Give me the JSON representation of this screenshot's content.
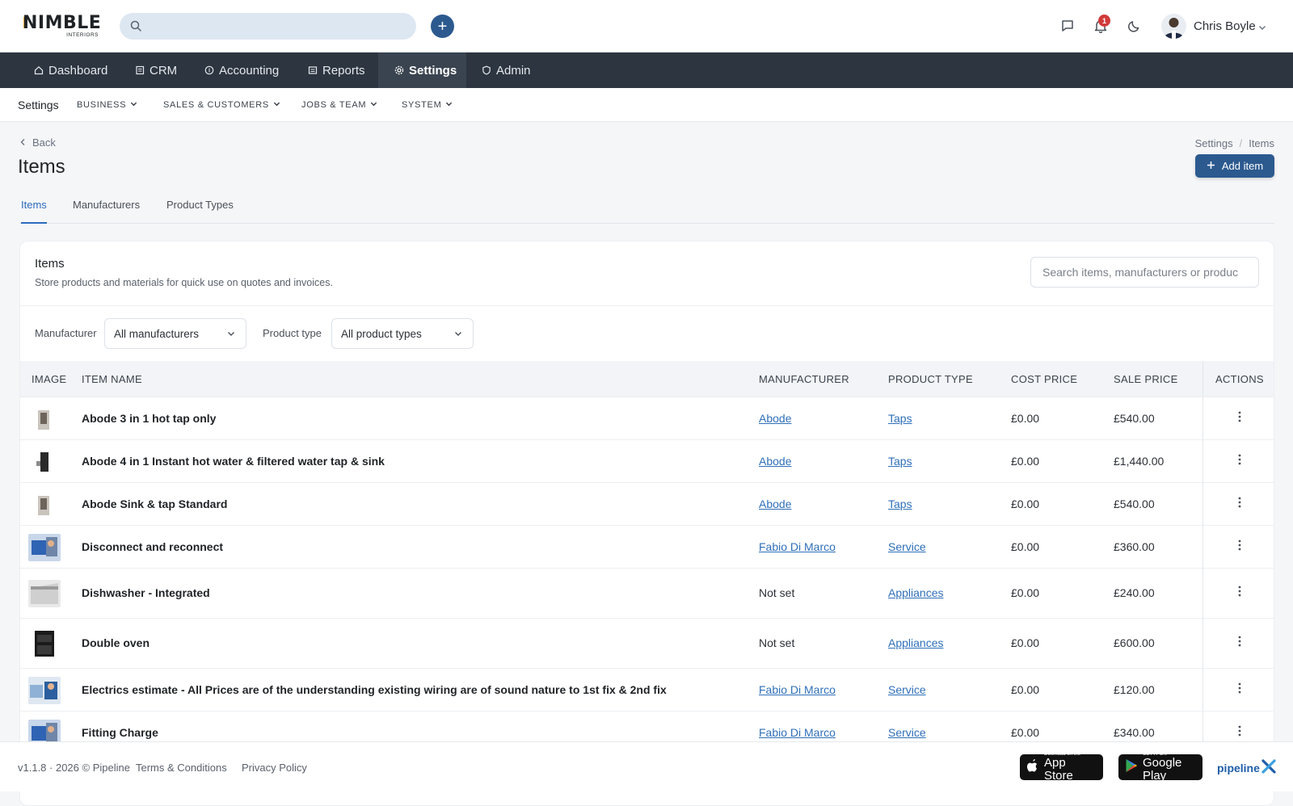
{
  "brand": {
    "name": "NIMBLE",
    "sub": "INTERIORS"
  },
  "header": {
    "search_placeholder": "",
    "quick_add_label": "+",
    "notification_count": "1",
    "user_name": "Chris Boyle"
  },
  "nav": {
    "items": [
      {
        "label": "Dashboard",
        "icon": "home-icon"
      },
      {
        "label": "CRM",
        "icon": "contacts-icon"
      },
      {
        "label": "Accounting",
        "icon": "coin-icon"
      },
      {
        "label": "Reports",
        "icon": "report-icon"
      },
      {
        "label": "Settings",
        "icon": "gear-icon",
        "active": true
      },
      {
        "label": "Admin",
        "icon": "shield-icon"
      }
    ]
  },
  "subnav": {
    "title": "Settings",
    "items": [
      "BUSINESS",
      "SALES & CUSTOMERS",
      "JOBS & TEAM",
      "SYSTEM"
    ]
  },
  "page": {
    "back": "Back",
    "title": "Items",
    "breadcrumb": [
      "Settings",
      "/",
      "Items"
    ],
    "add_button": "Add item"
  },
  "tabs": [
    "Items",
    "Manufacturers",
    "Product Types"
  ],
  "card": {
    "title": "Items",
    "subtitle": "Store products and materials for quick use on quotes and invoices.",
    "search_placeholder": "Search items, manufacturers or produc"
  },
  "filters": {
    "manufacturer_label": "Manufacturer",
    "manufacturer_value": "All manufacturers",
    "product_type_label": "Product type",
    "product_type_value": "All product types"
  },
  "table": {
    "headers": [
      "IMAGE",
      "ITEM NAME",
      "MANUFACTURER",
      "PRODUCT TYPE",
      "COST PRICE",
      "SALE PRICE",
      "ACTIONS"
    ],
    "rows": [
      {
        "name": "Abode 3 in 1 hot tap only",
        "manufacturer": "Abode",
        "manufacturer_link": true,
        "product_type": "Taps",
        "cost": "£0.00",
        "sale": "£540.00",
        "thumb": "tap"
      },
      {
        "name": "Abode 4 in 1 Instant hot water & filtered water tap & sink",
        "manufacturer": "Abode",
        "manufacturer_link": true,
        "product_type": "Taps",
        "cost": "£0.00",
        "sale": "£1,440.00",
        "thumb": "tap-dark"
      },
      {
        "name": "Abode Sink & tap Standard",
        "manufacturer": "Abode",
        "manufacturer_link": true,
        "product_type": "Taps",
        "cost": "£0.00",
        "sale": "£540.00",
        "thumb": "tap"
      },
      {
        "name": "Disconnect and reconnect",
        "manufacturer": "Fabio Di Marco",
        "manufacturer_link": true,
        "product_type": "Service",
        "cost": "£0.00",
        "sale": "£360.00",
        "thumb": "service"
      },
      {
        "name": "Dishwasher - Integrated",
        "manufacturer": "Not set",
        "manufacturer_link": false,
        "product_type": "Appliances",
        "cost": "£0.00",
        "sale": "£240.00",
        "thumb": "dishwasher"
      },
      {
        "name": "Double oven",
        "manufacturer": "Not set",
        "manufacturer_link": false,
        "product_type": "Appliances",
        "cost": "£0.00",
        "sale": "£600.00",
        "thumb": "oven"
      },
      {
        "name": "Electrics estimate - All Prices are of the understanding existing wiring are of sound nature to 1st fix & 2nd fix",
        "manufacturer": "Fabio Di Marco",
        "manufacturer_link": true,
        "product_type": "Service",
        "cost": "£0.00",
        "sale": "£120.00",
        "thumb": "electric"
      },
      {
        "name": "Fitting Charge",
        "manufacturer": "Fabio Di Marco",
        "manufacturer_link": true,
        "product_type": "Service",
        "cost": "£0.00",
        "sale": "£340.00",
        "thumb": "service"
      }
    ]
  },
  "footer": {
    "version": "v1.1.8 · 2026 © Pipeline",
    "terms": "Terms & Conditions",
    "privacy": "Privacy Policy",
    "app_store_small": "Download on the",
    "app_store_big": "App Store",
    "play_small": "GET IT ON",
    "play_big": "Google Play",
    "brand": "pipeline"
  },
  "colors": {
    "primary": "#2c5a8f",
    "nav_bg": "#2d3540",
    "link": "#2f6fb8",
    "badge": "#d13a3a"
  }
}
